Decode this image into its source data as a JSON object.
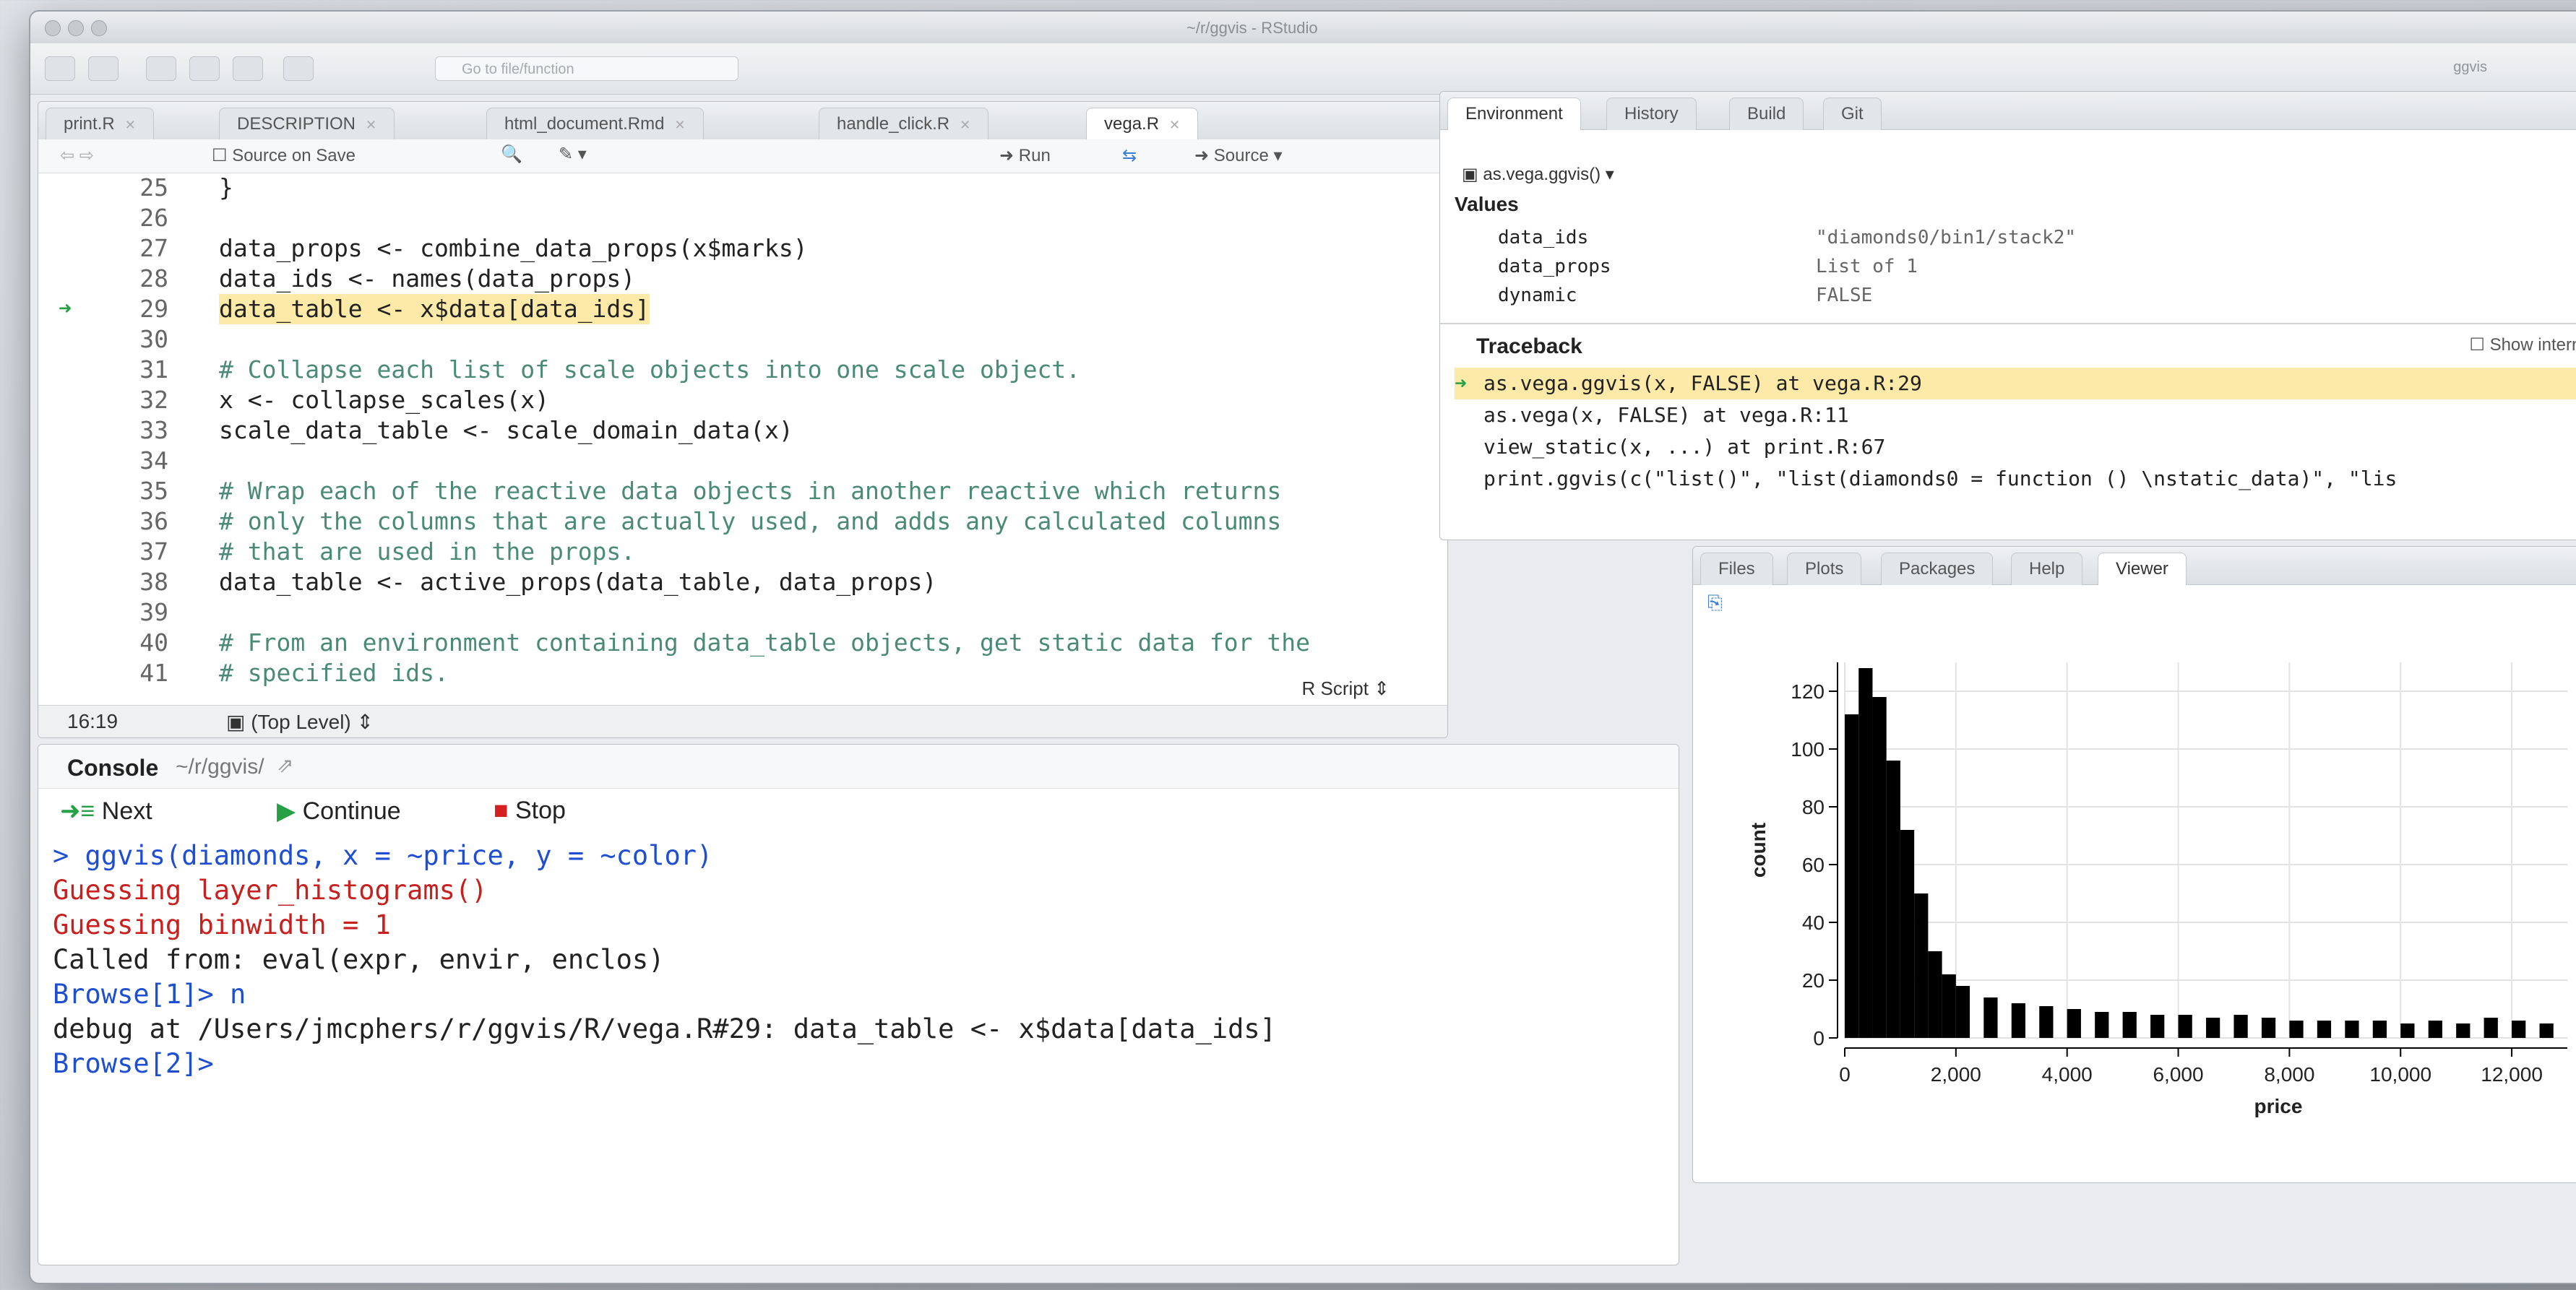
{
  "window": {
    "title": "~/r/ggvis - RStudio"
  },
  "toolbar": {
    "goto_placeholder": "Go to file/function",
    "project": "ggvis"
  },
  "editor": {
    "tabs": [
      "print.R",
      "DESCRIPTION",
      "html_document.Rmd",
      "handle_click.R",
      "vega.R"
    ],
    "source_on_save": "Source on Save",
    "run_label": "Run",
    "source_label": "Source",
    "lines": [
      {
        "n": "25",
        "t": "}"
      },
      {
        "n": "26",
        "t": ""
      },
      {
        "n": "27",
        "t": "data_props <- combine_data_props(x$marks)"
      },
      {
        "n": "28",
        "t": "data_ids <- names(data_props)"
      },
      {
        "n": "29",
        "t": "data_table <- x$data[data_ids]"
      },
      {
        "n": "30",
        "t": ""
      },
      {
        "n": "31",
        "t": "# Collapse each list of scale objects into one scale object."
      },
      {
        "n": "32",
        "t": "x <- collapse_scales(x)"
      },
      {
        "n": "33",
        "t": "scale_data_table <- scale_domain_data(x)"
      },
      {
        "n": "34",
        "t": ""
      },
      {
        "n": "35",
        "t": "# Wrap each of the reactive data objects in another reactive which returns"
      },
      {
        "n": "36",
        "t": "# only the columns that are actually used, and adds any calculated columns"
      },
      {
        "n": "37",
        "t": "# that are used in the props."
      },
      {
        "n": "38",
        "t": "data_table <- active_props(data_table, data_props)"
      },
      {
        "n": "39",
        "t": ""
      },
      {
        "n": "40",
        "t": "# From an environment containing data_table objects, get static data for the"
      },
      {
        "n": "41",
        "t": "# specified ids."
      }
    ],
    "cursor": "16:19",
    "scope": "(Top Level)",
    "filetype": "R Script"
  },
  "console": {
    "title": "Console",
    "path": "~/r/ggvis/",
    "next_label": "Next",
    "continue_label": "Continue",
    "stop_label": "Stop",
    "lines": [
      {
        "text": "> ggvis(diamonds, x = ~price, y = ~color)",
        "kind": "blue"
      },
      {
        "text": "Guessing layer_histograms()",
        "kind": "red"
      },
      {
        "text": "Guessing binwidth = 1",
        "kind": "red"
      },
      {
        "text": "Called from: eval(expr, envir, enclos)",
        "kind": "plain"
      },
      {
        "text": "Browse[1]> n",
        "kind": "blue"
      },
      {
        "text": "debug at /Users/jmcphers/r/ggvis/R/vega.R#29: data_table <- x$data[data_ids]",
        "kind": "plain"
      },
      {
        "text": "Browse[2]>",
        "kind": "blue"
      }
    ]
  },
  "environment": {
    "tabs": [
      "Environment",
      "History",
      "Build",
      "Git"
    ],
    "frame": "as.vega.ggvis()",
    "values_heading": "Values",
    "values": [
      {
        "name": "data_ids",
        "value": "\"diamonds0/bin1/stack2\""
      },
      {
        "name": "data_props",
        "value": "List of 1"
      },
      {
        "name": "dynamic",
        "value": "FALSE"
      }
    ],
    "traceback_heading": "Traceback",
    "show_internals": "Show internals",
    "traceback": [
      "as.vega.ggvis(x, FALSE) at vega.R:29",
      "as.vega(x, FALSE) at vega.R:11",
      "view_static(x, ...) at print.R:67",
      "print.ggvis(c(\"list()\", \"list(diamonds0 = function () \\nstatic_data)\", \"lis"
    ]
  },
  "viewer": {
    "tabs": [
      "Files",
      "Plots",
      "Packages",
      "Help",
      "Viewer"
    ]
  },
  "chart_data": {
    "type": "bar",
    "xlabel": "price",
    "ylabel": "count",
    "xlim": [
      0,
      13000
    ],
    "ylim": [
      0,
      130
    ],
    "x_ticks": [
      0,
      2000,
      4000,
      6000,
      8000,
      10000,
      12000
    ],
    "x_tick_labels": [
      "0",
      "2,000",
      "4,000",
      "6,000",
      "8,000",
      "10,000",
      "12,000"
    ],
    "y_ticks": [
      0,
      20,
      40,
      60,
      80,
      100,
      120
    ],
    "y_tick_labels": [
      "0",
      "20",
      "40",
      "60",
      "80",
      "100",
      "120"
    ],
    "grid": true,
    "bars": [
      {
        "x": 0,
        "y": 112
      },
      {
        "x": 250,
        "y": 128
      },
      {
        "x": 500,
        "y": 118
      },
      {
        "x": 750,
        "y": 96
      },
      {
        "x": 1000,
        "y": 72
      },
      {
        "x": 1250,
        "y": 50
      },
      {
        "x": 1500,
        "y": 30
      },
      {
        "x": 1750,
        "y": 22
      },
      {
        "x": 2000,
        "y": 18
      },
      {
        "x": 2500,
        "y": 14
      },
      {
        "x": 3000,
        "y": 12
      },
      {
        "x": 3500,
        "y": 11
      },
      {
        "x": 4000,
        "y": 10
      },
      {
        "x": 4500,
        "y": 9
      },
      {
        "x": 5000,
        "y": 9
      },
      {
        "x": 5500,
        "y": 8
      },
      {
        "x": 6000,
        "y": 8
      },
      {
        "x": 6500,
        "y": 7
      },
      {
        "x": 7000,
        "y": 8
      },
      {
        "x": 7500,
        "y": 7
      },
      {
        "x": 8000,
        "y": 6
      },
      {
        "x": 8500,
        "y": 6
      },
      {
        "x": 9000,
        "y": 6
      },
      {
        "x": 9500,
        "y": 6
      },
      {
        "x": 10000,
        "y": 5
      },
      {
        "x": 10500,
        "y": 6
      },
      {
        "x": 11000,
        "y": 5
      },
      {
        "x": 11500,
        "y": 7
      },
      {
        "x": 12000,
        "y": 6
      },
      {
        "x": 12500,
        "y": 5
      }
    ]
  }
}
